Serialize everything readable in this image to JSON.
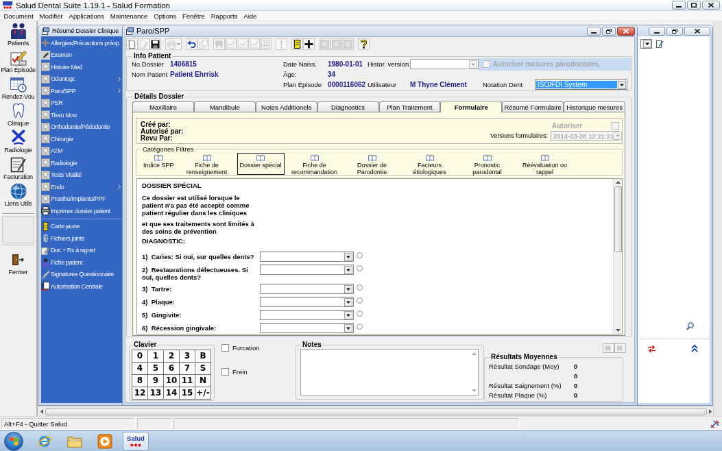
{
  "app_window": {
    "title": "Salud Dental Suite 1.19.1 - Salud Formation"
  },
  "menu_bar": [
    "Document",
    "Modifier",
    "Applications",
    "Maintenance",
    "Options",
    "Fenêtre",
    "Rapports",
    "Aide"
  ],
  "left_toolbar": {
    "items": [
      "Patients",
      "Plan Épisode",
      "Rendez-Vou",
      "Clinique",
      "Radiologie",
      "Facturation",
      "Liens Utils"
    ],
    "close_item": "Fermer"
  },
  "summary_window": {
    "title": "Résumé Dossier Clinique",
    "items": [
      {
        "label": "Allergies/Précautions préop.",
        "submenu": false
      },
      {
        "label": "Examen",
        "submenu": false
      },
      {
        "label": "Histoire Med",
        "submenu": false
      },
      {
        "label": "Odontogr.",
        "submenu": true
      },
      {
        "label": "Paro/SPP",
        "submenu": true
      },
      {
        "label": "PSR",
        "submenu": false
      },
      {
        "label": "Tissu Mou",
        "submenu": false
      },
      {
        "label": "Orthodontie/Pédodontie",
        "submenu": false
      },
      {
        "label": "Chirurgie",
        "submenu": false
      },
      {
        "label": "ATM",
        "submenu": false
      },
      {
        "label": "Radiologie",
        "submenu": false
      },
      {
        "label": "Tests Vitalité",
        "submenu": false
      },
      {
        "label": "Endo",
        "submenu": true
      },
      {
        "label": "Prostho/Implanto/PPF",
        "submenu": false
      },
      {
        "label": "Imprimer dossier patient",
        "submenu": false
      }
    ],
    "extra_items": [
      "Carte jaune",
      "Fichiers joints",
      "Doc + Rx à signer",
      "Fiche patient",
      "Signatures Questionnaire",
      "Autorisation Centrale"
    ]
  },
  "paro_window": {
    "title": "Paro/SPP",
    "toolbar": [
      {
        "disabled": false
      },
      {
        "disabled": true
      },
      {
        "disabled": false
      },
      {
        "disabled": true
      },
      {
        "disabled": false
      },
      {
        "disabled": true
      },
      {
        "disabled": true
      },
      {
        "disabled": true
      },
      {
        "disabled": true
      },
      {
        "disabled": true
      },
      {
        "disabled": true
      },
      {
        "disabled": true
      },
      {
        "disabled": false
      },
      {
        "disabled": false
      },
      {
        "disabled": true
      },
      {
        "disabled": true
      },
      {
        "disabled": true
      },
      {
        "disabled": false
      }
    ],
    "info_patient": {
      "legend": "Info Patient",
      "dossier_label": "No.Dossier",
      "dossier": "1406815",
      "name_label": "Nom Patient",
      "name": "Patient Ehrrisk",
      "birth_label": "Date Naiss.",
      "birth": "1980-01-01",
      "age_label": "Âge:",
      "age": "34",
      "episode_label": "Plan Épisode",
      "episode": "0000116062",
      "version_label": "Histor. version",
      "user_label": "Utilisateur",
      "user": "M Thyne Clément",
      "authorize": {
        "label": "Autoriser mesures parodontales.",
        "checked": false,
        "disabled": true
      },
      "notation_label": "Notation Dent",
      "notation": "ISO/FDI System"
    },
    "details": {
      "legend": "Détails Dossier",
      "tabs": [
        {
          "label": "Maxillaire",
          "selected": false
        },
        {
          "label": "Mandibule",
          "selected": false
        },
        {
          "label": "Notes Additionels",
          "selected": false
        },
        {
          "label": "Diagnostics",
          "selected": false
        },
        {
          "label": "Plan Traitement",
          "selected": false
        },
        {
          "label": "Formulaire",
          "selected": true
        },
        {
          "label": "Résumé Formulaire",
          "selected": false
        },
        {
          "label": "Historique mesures",
          "selected": false
        }
      ],
      "form_header": {
        "created_label": "Créé par:",
        "authorized_label": "Autorisé par:",
        "reviewed_label": "Revu Par:",
        "authorize": {
          "label": "Autoriser",
          "checked": false,
          "disabled": true
        },
        "versions_label": "Versions formulaires:",
        "version": {
          "value": "2014-03-28 12:21:21",
          "disabled": true
        }
      },
      "categories": {
        "legend": "Catégories Filtres",
        "items": [
          {
            "label": "Indice SPP",
            "selected": false
          },
          {
            "label": "Fiche de renseignement",
            "selected": false
          },
          {
            "label": "Dossier spécial",
            "selected": true
          },
          {
            "label": "Fiche de recommandation",
            "selected": false
          },
          {
            "label": "Dossier de Parodontie",
            "selected": false
          },
          {
            "label": "Facteurs étiologiques",
            "selected": false
          },
          {
            "label": "Pronostic parodontal",
            "selected": false
          },
          {
            "label": "Réévaluation ou rappel",
            "selected": false
          }
        ]
      },
      "form": {
        "title": "DOSSIER SPÉCIAL",
        "paragraphs": [
          "Ce dossier est utilisé lorsque le patient n'a pas été accepté comme patient régulier dans les cliniques",
          "et que ses traitements sont limités à des soins de prévention"
        ],
        "section": "DIAGNOSTIC:",
        "questions": [
          {
            "label": "1)  Caries: Si oui, sur quelles dents?",
            "checked": false
          },
          {
            "label": "2)  Restaurations défectueuses. Si oui, quelles dents?",
            "checked": false
          },
          {
            "label": "3)  Tartre:",
            "checked": false
          },
          {
            "label": "4)  Plaque:",
            "checked": false
          },
          {
            "label": "5)  Gingivite:",
            "checked": false
          },
          {
            "label": "6)  Récession gingivale:",
            "checked": false
          }
        ]
      }
    },
    "keypad": {
      "legend": "Clavier",
      "keys": [
        "0",
        "1",
        "2",
        "3",
        "B",
        "4",
        "5",
        "6",
        "7",
        "S",
        "8",
        "9",
        "10",
        "11",
        "N",
        "12",
        "13",
        "14",
        "15",
        "+/-"
      ]
    },
    "options": [
      {
        "label": "Furcation",
        "checked": false
      },
      {
        "label": "Frein",
        "checked": false
      }
    ],
    "notes": {
      "legend": "Notes"
    },
    "side_buttons": [
      {
        "disabled": true
      },
      {
        "disabled": true
      }
    ],
    "results": {
      "legend": "Résultats Moyennes",
      "rows": [
        {
          "label": "Résultat Sondage (Moy)",
          "value": "0"
        },
        {
          "value": "0"
        },
        {
          "label": "Résultat Saignement (%)",
          "value": "0"
        },
        {
          "label": "Résultat Plaque (%)",
          "value": "0"
        }
      ]
    }
  },
  "status_bar": {
    "message": "Alt+F4 - Quitter Salud"
  },
  "taskbar": {
    "app_label": "Salud"
  }
}
